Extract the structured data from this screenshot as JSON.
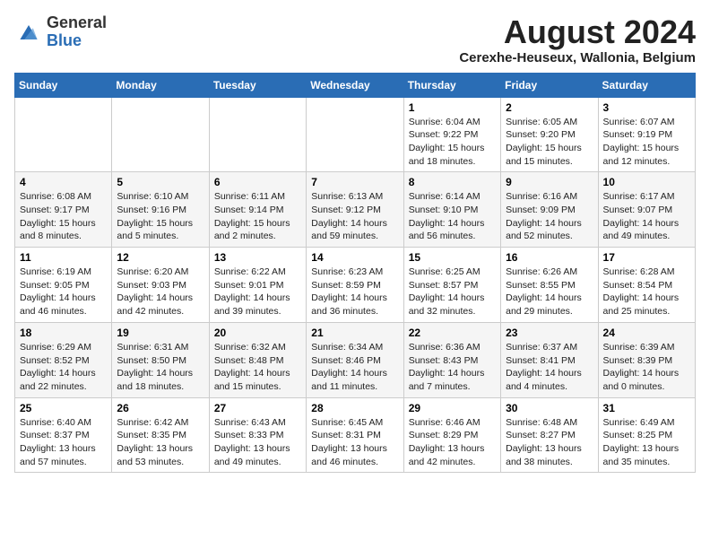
{
  "header": {
    "logo_general": "General",
    "logo_blue": "Blue",
    "month_year": "August 2024",
    "location": "Cerexhe-Heuseux, Wallonia, Belgium"
  },
  "weekdays": [
    "Sunday",
    "Monday",
    "Tuesday",
    "Wednesday",
    "Thursday",
    "Friday",
    "Saturday"
  ],
  "weeks": [
    [
      {
        "day": "",
        "sunrise": "",
        "sunset": "",
        "daylight": ""
      },
      {
        "day": "",
        "sunrise": "",
        "sunset": "",
        "daylight": ""
      },
      {
        "day": "",
        "sunrise": "",
        "sunset": "",
        "daylight": ""
      },
      {
        "day": "",
        "sunrise": "",
        "sunset": "",
        "daylight": ""
      },
      {
        "day": "1",
        "sunrise": "6:04 AM",
        "sunset": "9:22 PM",
        "daylight": "15 hours and 18 minutes."
      },
      {
        "day": "2",
        "sunrise": "6:05 AM",
        "sunset": "9:20 PM",
        "daylight": "15 hours and 15 minutes."
      },
      {
        "day": "3",
        "sunrise": "6:07 AM",
        "sunset": "9:19 PM",
        "daylight": "15 hours and 12 minutes."
      }
    ],
    [
      {
        "day": "4",
        "sunrise": "6:08 AM",
        "sunset": "9:17 PM",
        "daylight": "15 hours and 8 minutes."
      },
      {
        "day": "5",
        "sunrise": "6:10 AM",
        "sunset": "9:16 PM",
        "daylight": "15 hours and 5 minutes."
      },
      {
        "day": "6",
        "sunrise": "6:11 AM",
        "sunset": "9:14 PM",
        "daylight": "15 hours and 2 minutes."
      },
      {
        "day": "7",
        "sunrise": "6:13 AM",
        "sunset": "9:12 PM",
        "daylight": "14 hours and 59 minutes."
      },
      {
        "day": "8",
        "sunrise": "6:14 AM",
        "sunset": "9:10 PM",
        "daylight": "14 hours and 56 minutes."
      },
      {
        "day": "9",
        "sunrise": "6:16 AM",
        "sunset": "9:09 PM",
        "daylight": "14 hours and 52 minutes."
      },
      {
        "day": "10",
        "sunrise": "6:17 AM",
        "sunset": "9:07 PM",
        "daylight": "14 hours and 49 minutes."
      }
    ],
    [
      {
        "day": "11",
        "sunrise": "6:19 AM",
        "sunset": "9:05 PM",
        "daylight": "14 hours and 46 minutes."
      },
      {
        "day": "12",
        "sunrise": "6:20 AM",
        "sunset": "9:03 PM",
        "daylight": "14 hours and 42 minutes."
      },
      {
        "day": "13",
        "sunrise": "6:22 AM",
        "sunset": "9:01 PM",
        "daylight": "14 hours and 39 minutes."
      },
      {
        "day": "14",
        "sunrise": "6:23 AM",
        "sunset": "8:59 PM",
        "daylight": "14 hours and 36 minutes."
      },
      {
        "day": "15",
        "sunrise": "6:25 AM",
        "sunset": "8:57 PM",
        "daylight": "14 hours and 32 minutes."
      },
      {
        "day": "16",
        "sunrise": "6:26 AM",
        "sunset": "8:55 PM",
        "daylight": "14 hours and 29 minutes."
      },
      {
        "day": "17",
        "sunrise": "6:28 AM",
        "sunset": "8:54 PM",
        "daylight": "14 hours and 25 minutes."
      }
    ],
    [
      {
        "day": "18",
        "sunrise": "6:29 AM",
        "sunset": "8:52 PM",
        "daylight": "14 hours and 22 minutes."
      },
      {
        "day": "19",
        "sunrise": "6:31 AM",
        "sunset": "8:50 PM",
        "daylight": "14 hours and 18 minutes."
      },
      {
        "day": "20",
        "sunrise": "6:32 AM",
        "sunset": "8:48 PM",
        "daylight": "14 hours and 15 minutes."
      },
      {
        "day": "21",
        "sunrise": "6:34 AM",
        "sunset": "8:46 PM",
        "daylight": "14 hours and 11 minutes."
      },
      {
        "day": "22",
        "sunrise": "6:36 AM",
        "sunset": "8:43 PM",
        "daylight": "14 hours and 7 minutes."
      },
      {
        "day": "23",
        "sunrise": "6:37 AM",
        "sunset": "8:41 PM",
        "daylight": "14 hours and 4 minutes."
      },
      {
        "day": "24",
        "sunrise": "6:39 AM",
        "sunset": "8:39 PM",
        "daylight": "14 hours and 0 minutes."
      }
    ],
    [
      {
        "day": "25",
        "sunrise": "6:40 AM",
        "sunset": "8:37 PM",
        "daylight": "13 hours and 57 minutes."
      },
      {
        "day": "26",
        "sunrise": "6:42 AM",
        "sunset": "8:35 PM",
        "daylight": "13 hours and 53 minutes."
      },
      {
        "day": "27",
        "sunrise": "6:43 AM",
        "sunset": "8:33 PM",
        "daylight": "13 hours and 49 minutes."
      },
      {
        "day": "28",
        "sunrise": "6:45 AM",
        "sunset": "8:31 PM",
        "daylight": "13 hours and 46 minutes."
      },
      {
        "day": "29",
        "sunrise": "6:46 AM",
        "sunset": "8:29 PM",
        "daylight": "13 hours and 42 minutes."
      },
      {
        "day": "30",
        "sunrise": "6:48 AM",
        "sunset": "8:27 PM",
        "daylight": "13 hours and 38 minutes."
      },
      {
        "day": "31",
        "sunrise": "6:49 AM",
        "sunset": "8:25 PM",
        "daylight": "13 hours and 35 minutes."
      }
    ]
  ]
}
